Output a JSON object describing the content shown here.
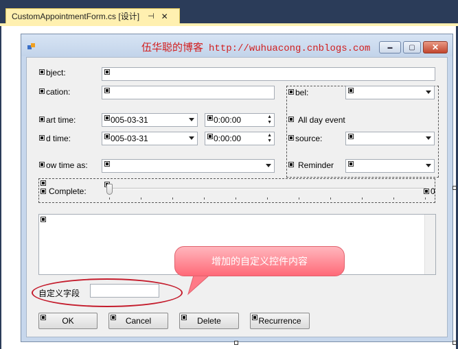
{
  "doc_tab": {
    "title": "CustomAppointmentForm.cs [设计]",
    "pin": "⊣",
    "close": "✕"
  },
  "form": {
    "title_text": "伍华聪的博客",
    "title_url": "http://wuhuacong.cnblogs.com",
    "window_buttons": {
      "minimize": "▬",
      "maximize": "▢",
      "close": "✕"
    }
  },
  "fields": {
    "subject_label": "bject:",
    "location_label": "cation:",
    "label_label": "bel:",
    "start_time_label": "art time:",
    "start_date": "005-03-31",
    "start_clock": "0:00:00",
    "all_day_label": "All day event",
    "end_time_label": "d time:",
    "end_date": "005-03-31",
    "end_clock": "0:00:00",
    "resource_label": "source:",
    "show_time_label": "ow time as:",
    "reminder_label": "Reminder",
    "complete_label": "Complete:",
    "complete_value": "0"
  },
  "custom": {
    "field_label": "自定义字段",
    "field_value": ""
  },
  "buttons": {
    "ok": "OK",
    "cancel": "Cancel",
    "delete": "Delete",
    "recurrence": "Recurrence"
  },
  "callout": {
    "text": "增加的自定义控件内容"
  },
  "colors": {
    "title_red": "#d21e1e",
    "callout_pink": "#ff7a87",
    "oval_red": "#c41c2c"
  }
}
